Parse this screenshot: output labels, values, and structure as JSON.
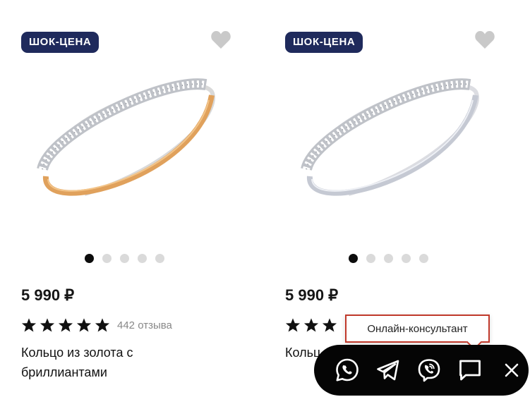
{
  "products": [
    {
      "badge": "ШОК-ЦЕНА",
      "price": "5 990 ₽",
      "rating": 5,
      "reviews": "442 отзыва",
      "title": "Кольцо из золота с бриллиантами",
      "slides": 5,
      "active_slide": 1,
      "band_color": "#e2a45a"
    },
    {
      "badge": "ШОК-ЦЕНА",
      "price": "5 990 ₽",
      "rating": 5,
      "title": "Кольц… бриллиантами",
      "slides": 5,
      "active_slide": 1,
      "band_color": "#c8ccd6"
    }
  ],
  "consultant_tooltip": "Онлайн-консультант",
  "chat_buttons": [
    "whatsapp-icon",
    "telegram-icon",
    "viber-icon",
    "chat-icon",
    "close-icon"
  ],
  "colors": {
    "badge_bg": "#1f2a5c",
    "bar_bg": "#050505",
    "tooltip_border": "#c0392b"
  }
}
